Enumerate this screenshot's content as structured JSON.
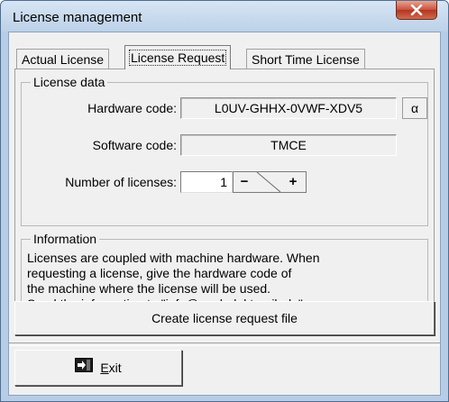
{
  "window": {
    "title": "License management"
  },
  "tabs": [
    {
      "label": "Actual License",
      "active": false
    },
    {
      "label": "License Request",
      "active": true
    },
    {
      "label": "Short Time License",
      "active": false
    }
  ],
  "license_data": {
    "legend": "License data",
    "hardware_code_label": "Hardware code:",
    "hardware_code_value": "L0UV-GHHX-0VWF-XDV5",
    "alpha_button_label": "α",
    "software_code_label": "Software code:",
    "software_code_value": "TMCE",
    "licenses_label": "Number of licenses:",
    "licenses_value": "1",
    "minus_label": "−",
    "plus_label": "+"
  },
  "information": {
    "legend": "Information",
    "lines": [
      "Licenses are coupled with machine hardware. When",
      "requesting a license, give the hardware code of",
      "the machine where the license will be used.",
      "Send the information to \"info@mcd-elektronik.de\"."
    ]
  },
  "create_button_label": "Create license request file",
  "exit_button": {
    "prefix": "E",
    "rest": "xit"
  },
  "colors": {
    "titlebar": "#bcd1e8",
    "close": "#c8503b",
    "dialog_bg": "#f0f0f0"
  }
}
